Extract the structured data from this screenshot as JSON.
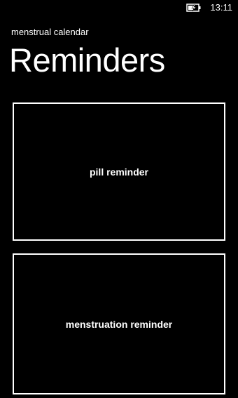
{
  "status_bar": {
    "battery_icon": "battery-charging-icon",
    "time": "13:11"
  },
  "header": {
    "app_title": "menstrual calendar",
    "page_title": "Reminders"
  },
  "tiles": [
    {
      "label": "pill reminder"
    },
    {
      "label": "menstruation reminder"
    }
  ],
  "colors": {
    "background": "#000000",
    "foreground": "#ffffff"
  }
}
